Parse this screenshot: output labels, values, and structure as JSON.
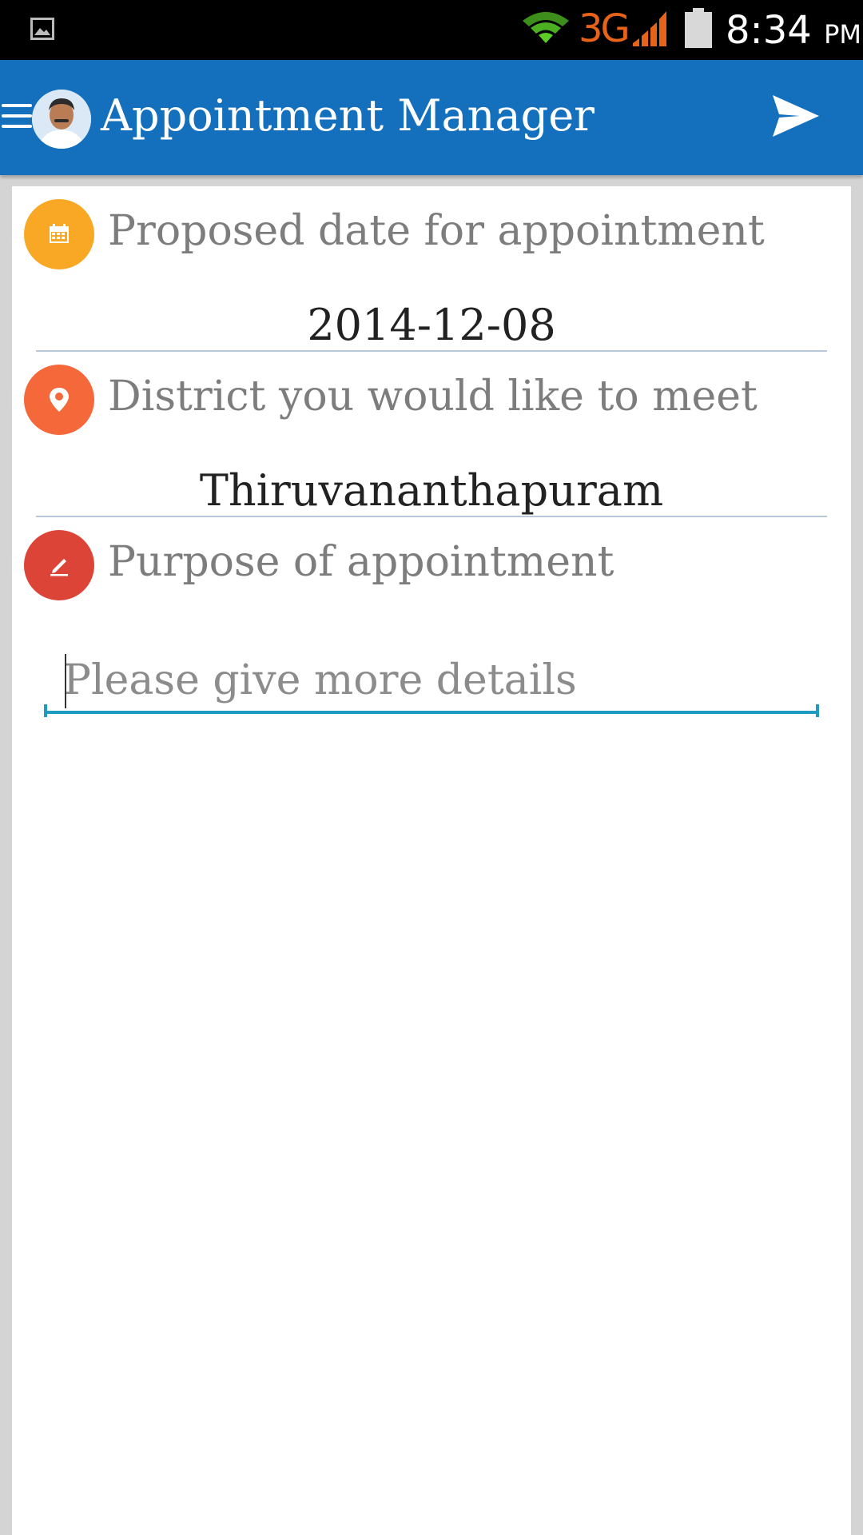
{
  "status_bar": {
    "network_type": "3G",
    "time": "8:34",
    "ampm": "PM"
  },
  "app_bar": {
    "title": "Appointment Manager"
  },
  "form": {
    "date_field": {
      "label": "Proposed date for appointment",
      "value": "2014-12-08",
      "icon": "calendar-icon",
      "icon_color": "#f9a825"
    },
    "district_field": {
      "label": "District you would like to meet",
      "value": "Thiruvananthapuram",
      "icon": "location-pin-icon",
      "icon_color": "#f4683a"
    },
    "purpose_field": {
      "label": "Purpose of appointment",
      "icon": "pencil-icon",
      "icon_color": "#dd4438",
      "details_value": "",
      "details_placeholder": "Please give more details"
    }
  },
  "colors": {
    "app_bar": "#1470bd",
    "input_underline": "#1e9bc0",
    "divider": "#b9c8d8"
  }
}
